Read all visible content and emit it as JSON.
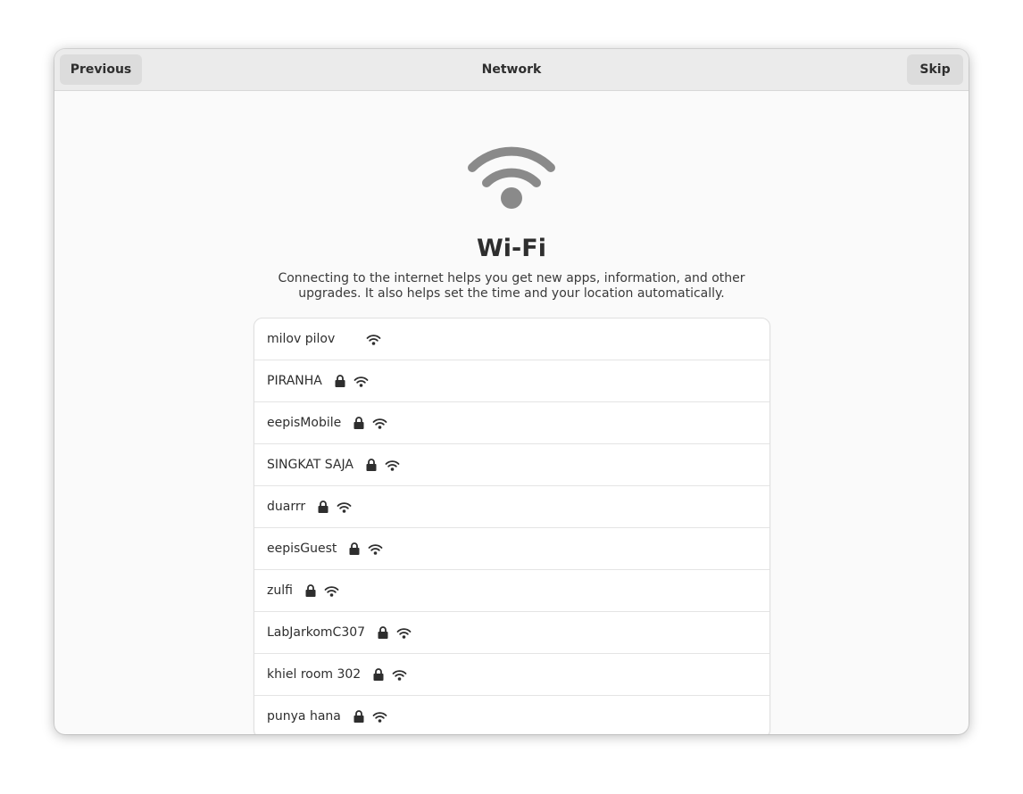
{
  "header": {
    "title": "Network",
    "previous_label": "Previous",
    "skip_label": "Skip"
  },
  "main": {
    "icon": "wifi-icon",
    "title": "Wi-Fi",
    "description": "Connecting to the internet helps you get new apps, information, and other upgrades. It also helps set the time and your location automatically."
  },
  "networks": [
    {
      "name": "milov pilov",
      "secured": false
    },
    {
      "name": "PIRANHA",
      "secured": true
    },
    {
      "name": "eepisMobile",
      "secured": true
    },
    {
      "name": "SINGKAT SAJA",
      "secured": true
    },
    {
      "name": "duarrr",
      "secured": true
    },
    {
      "name": "eepisGuest",
      "secured": true
    },
    {
      "name": "zulfi",
      "secured": true
    },
    {
      "name": "LabJarkomC307",
      "secured": true
    },
    {
      "name": "khiel room 302",
      "secured": true
    },
    {
      "name": "punya hana",
      "secured": true
    }
  ],
  "colors": {
    "accent_icon": "#8a8a8a",
    "text": "#2e2e2e",
    "headerbar": "#ebebeb"
  }
}
